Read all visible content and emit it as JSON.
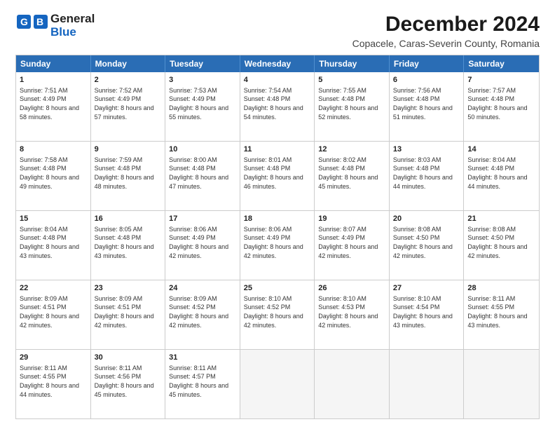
{
  "header": {
    "logo_line1": "General",
    "logo_line2": "Blue",
    "main_title": "December 2024",
    "subtitle": "Copacele, Caras-Severin County, Romania"
  },
  "days_of_week": [
    "Sunday",
    "Monday",
    "Tuesday",
    "Wednesday",
    "Thursday",
    "Friday",
    "Saturday"
  ],
  "weeks": [
    [
      {
        "day": "1",
        "rise": "Sunrise: 7:51 AM",
        "set": "Sunset: 4:49 PM",
        "daylight": "Daylight: 8 hours and 58 minutes."
      },
      {
        "day": "2",
        "rise": "Sunrise: 7:52 AM",
        "set": "Sunset: 4:49 PM",
        "daylight": "Daylight: 8 hours and 57 minutes."
      },
      {
        "day": "3",
        "rise": "Sunrise: 7:53 AM",
        "set": "Sunset: 4:49 PM",
        "daylight": "Daylight: 8 hours and 55 minutes."
      },
      {
        "day": "4",
        "rise": "Sunrise: 7:54 AM",
        "set": "Sunset: 4:48 PM",
        "daylight": "Daylight: 8 hours and 54 minutes."
      },
      {
        "day": "5",
        "rise": "Sunrise: 7:55 AM",
        "set": "Sunset: 4:48 PM",
        "daylight": "Daylight: 8 hours and 52 minutes."
      },
      {
        "day": "6",
        "rise": "Sunrise: 7:56 AM",
        "set": "Sunset: 4:48 PM",
        "daylight": "Daylight: 8 hours and 51 minutes."
      },
      {
        "day": "7",
        "rise": "Sunrise: 7:57 AM",
        "set": "Sunset: 4:48 PM",
        "daylight": "Daylight: 8 hours and 50 minutes."
      }
    ],
    [
      {
        "day": "8",
        "rise": "Sunrise: 7:58 AM",
        "set": "Sunset: 4:48 PM",
        "daylight": "Daylight: 8 hours and 49 minutes."
      },
      {
        "day": "9",
        "rise": "Sunrise: 7:59 AM",
        "set": "Sunset: 4:48 PM",
        "daylight": "Daylight: 8 hours and 48 minutes."
      },
      {
        "day": "10",
        "rise": "Sunrise: 8:00 AM",
        "set": "Sunset: 4:48 PM",
        "daylight": "Daylight: 8 hours and 47 minutes."
      },
      {
        "day": "11",
        "rise": "Sunrise: 8:01 AM",
        "set": "Sunset: 4:48 PM",
        "daylight": "Daylight: 8 hours and 46 minutes."
      },
      {
        "day": "12",
        "rise": "Sunrise: 8:02 AM",
        "set": "Sunset: 4:48 PM",
        "daylight": "Daylight: 8 hours and 45 minutes."
      },
      {
        "day": "13",
        "rise": "Sunrise: 8:03 AM",
        "set": "Sunset: 4:48 PM",
        "daylight": "Daylight: 8 hours and 44 minutes."
      },
      {
        "day": "14",
        "rise": "Sunrise: 8:04 AM",
        "set": "Sunset: 4:48 PM",
        "daylight": "Daylight: 8 hours and 44 minutes."
      }
    ],
    [
      {
        "day": "15",
        "rise": "Sunrise: 8:04 AM",
        "set": "Sunset: 4:48 PM",
        "daylight": "Daylight: 8 hours and 43 minutes."
      },
      {
        "day": "16",
        "rise": "Sunrise: 8:05 AM",
        "set": "Sunset: 4:48 PM",
        "daylight": "Daylight: 8 hours and 43 minutes."
      },
      {
        "day": "17",
        "rise": "Sunrise: 8:06 AM",
        "set": "Sunset: 4:49 PM",
        "daylight": "Daylight: 8 hours and 42 minutes."
      },
      {
        "day": "18",
        "rise": "Sunrise: 8:06 AM",
        "set": "Sunset: 4:49 PM",
        "daylight": "Daylight: 8 hours and 42 minutes."
      },
      {
        "day": "19",
        "rise": "Sunrise: 8:07 AM",
        "set": "Sunset: 4:49 PM",
        "daylight": "Daylight: 8 hours and 42 minutes."
      },
      {
        "day": "20",
        "rise": "Sunrise: 8:08 AM",
        "set": "Sunset: 4:50 PM",
        "daylight": "Daylight: 8 hours and 42 minutes."
      },
      {
        "day": "21",
        "rise": "Sunrise: 8:08 AM",
        "set": "Sunset: 4:50 PM",
        "daylight": "Daylight: 8 hours and 42 minutes."
      }
    ],
    [
      {
        "day": "22",
        "rise": "Sunrise: 8:09 AM",
        "set": "Sunset: 4:51 PM",
        "daylight": "Daylight: 8 hours and 42 minutes."
      },
      {
        "day": "23",
        "rise": "Sunrise: 8:09 AM",
        "set": "Sunset: 4:51 PM",
        "daylight": "Daylight: 8 hours and 42 minutes."
      },
      {
        "day": "24",
        "rise": "Sunrise: 8:09 AM",
        "set": "Sunset: 4:52 PM",
        "daylight": "Daylight: 8 hours and 42 minutes."
      },
      {
        "day": "25",
        "rise": "Sunrise: 8:10 AM",
        "set": "Sunset: 4:52 PM",
        "daylight": "Daylight: 8 hours and 42 minutes."
      },
      {
        "day": "26",
        "rise": "Sunrise: 8:10 AM",
        "set": "Sunset: 4:53 PM",
        "daylight": "Daylight: 8 hours and 42 minutes."
      },
      {
        "day": "27",
        "rise": "Sunrise: 8:10 AM",
        "set": "Sunset: 4:54 PM",
        "daylight": "Daylight: 8 hours and 43 minutes."
      },
      {
        "day": "28",
        "rise": "Sunrise: 8:11 AM",
        "set": "Sunset: 4:55 PM",
        "daylight": "Daylight: 8 hours and 43 minutes."
      }
    ],
    [
      {
        "day": "29",
        "rise": "Sunrise: 8:11 AM",
        "set": "Sunset: 4:55 PM",
        "daylight": "Daylight: 8 hours and 44 minutes."
      },
      {
        "day": "30",
        "rise": "Sunrise: 8:11 AM",
        "set": "Sunset: 4:56 PM",
        "daylight": "Daylight: 8 hours and 45 minutes."
      },
      {
        "day": "31",
        "rise": "Sunrise: 8:11 AM",
        "set": "Sunset: 4:57 PM",
        "daylight": "Daylight: 8 hours and 45 minutes."
      },
      null,
      null,
      null,
      null
    ]
  ]
}
